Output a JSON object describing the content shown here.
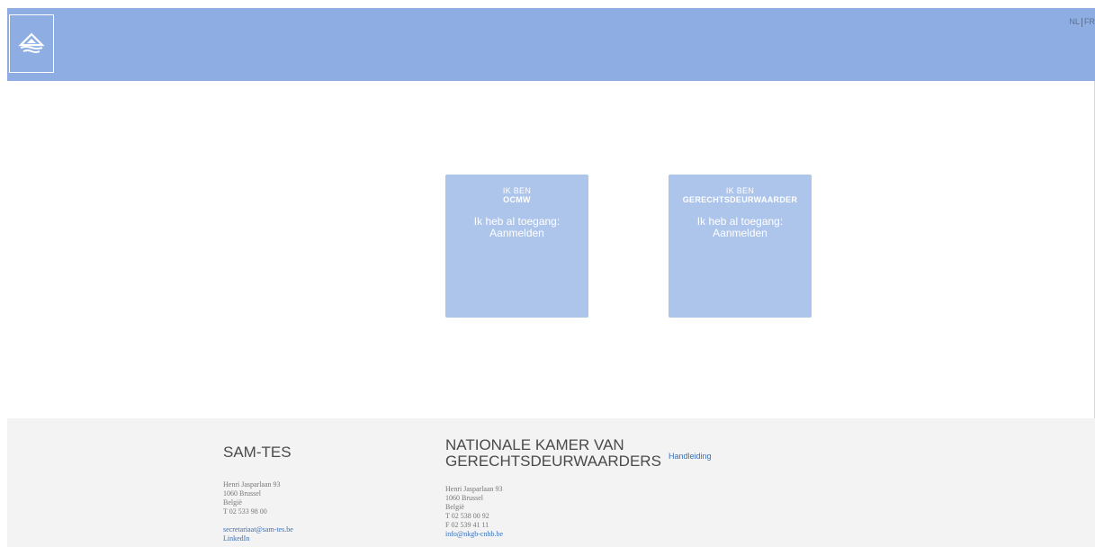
{
  "header": {
    "logo_icon": "samtes-diamond-logo-icon",
    "languages": [
      "NL",
      "FR"
    ]
  },
  "cards": [
    {
      "prefix": "IK BEN",
      "role": "OCMW",
      "access": "Ik heb al toegang:",
      "login": "Aanmelden"
    },
    {
      "prefix": "IK BEN",
      "role": "GERECHTSDEURWAARDER",
      "access": "Ik heb al toegang:",
      "login": "Aanmelden"
    }
  ],
  "footer": {
    "samtes": {
      "title": "SAM-TES",
      "address": [
        "Henri Jasparlaan 93",
        "1060 Brussel",
        "België",
        "T 02 533 98 00"
      ],
      "email": "secretariaat@sam-tes.be",
      "extra": "LinkedIn"
    },
    "nkgb": {
      "title_line1": "NATIONALE KAMER VAN",
      "title_line2": "GERECHTSDEURWAARDERS",
      "address": [
        "Henri Jasparlaan 93",
        "1060 Brussel",
        "België",
        "T 02 538 00 92",
        "F 02 539 41 11"
      ],
      "email": "info@nkgb-cnhb.be"
    },
    "manual": "Handleiding"
  },
  "colors": {
    "header": "#8eaee3",
    "card": "#aec5eb",
    "footer": "#f3f3f3",
    "link": "#3a6fb5"
  }
}
